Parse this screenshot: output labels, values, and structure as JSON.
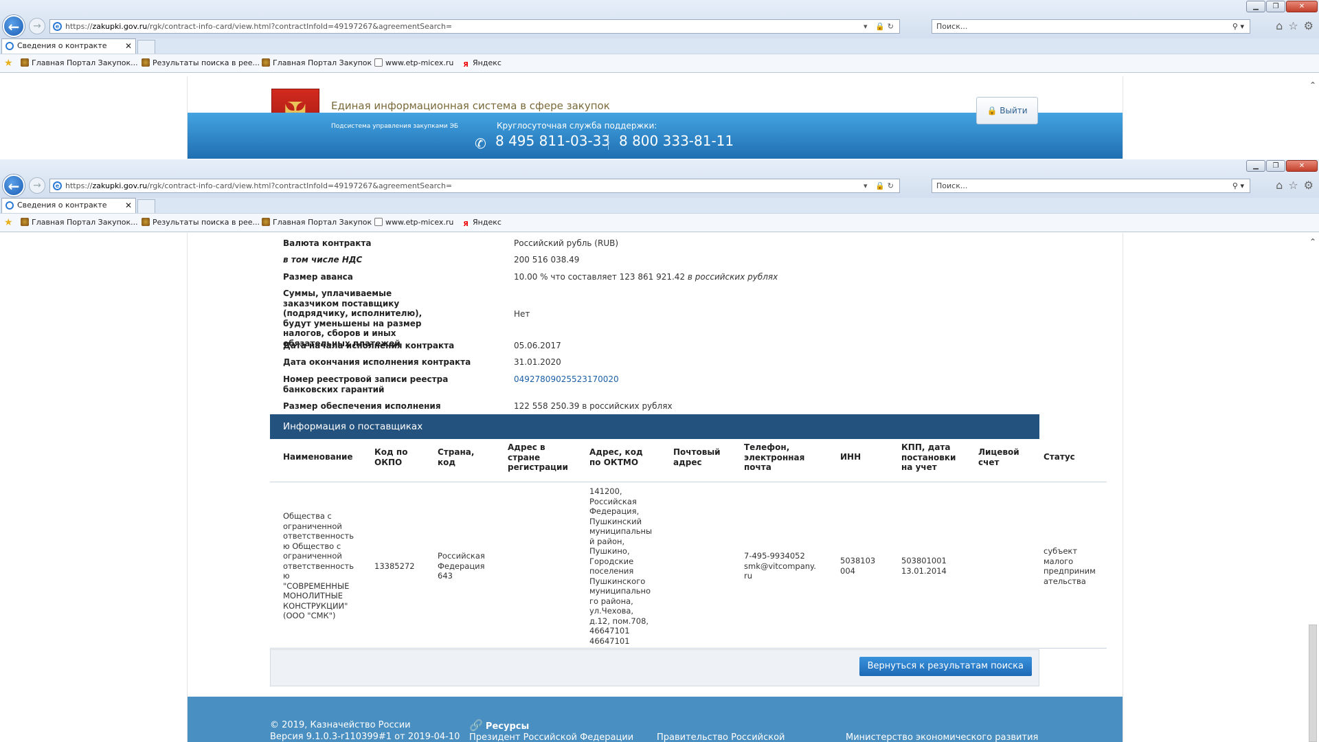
{
  "browser": {
    "url_prefix": "https://",
    "url_domain": "zakupki.gov.ru",
    "url_path": "/rgk/contract-info-card/view.html?contractInfoId=49197267&agreementSearch=",
    "search_placeholder": "Поиск...",
    "tab_title": "Сведения о контракте",
    "favorites": [
      "Главная Портал Закупок...",
      "Результаты поиска в рее...",
      "Главная Портал Закупок",
      "www.etp-micex.ru",
      "Яндекс"
    ]
  },
  "header": {
    "title": "Единая информационная система в сфере закупок",
    "subsystem": "Подсистема управления закупками ЭБ",
    "hotline_label": "Круглосуточная служба поддержки:",
    "phone1": "8 495 811-03-33",
    "phone2": "8 800 333-81-11",
    "logout_label": "Выйти"
  },
  "contract": {
    "rows": [
      {
        "k": "Валюта контракта",
        "v": "Российский рубль (RUB)"
      },
      {
        "k": "в том числе НДС",
        "v": "200 516 038.49"
      },
      {
        "k": "Размер аванса",
        "v": "10.00 % что составляет 123 861 921.42",
        "v_em": "в российских рублях"
      },
      {
        "k": "Суммы, уплачиваемые заказчиком поставщику (подрядчику, исполнителю), будут уменьшены на размер налогов, сборов и иных обязательных платежей",
        "v": "Нет"
      },
      {
        "k": "Дата начала исполнения контракта",
        "v": "05.06.2017"
      },
      {
        "k": "Дата окончания исполнения контракта",
        "v": "31.01.2020"
      },
      {
        "k": "Номер реестровой записи реестра банковских гарантий",
        "v": "04927809025523170020"
      },
      {
        "k": "Размер обеспечения исполнения контракта",
        "v": "122 558 250.39 в российских рублях"
      }
    ]
  },
  "suppliers": {
    "section_title": "Информация о поставщиках",
    "columns": [
      "Наименование",
      "Код по ОКПО",
      "Страна, код",
      "Адрес в стране регистрации",
      "Адрес, код по ОКТМО",
      "Почтовый адрес",
      "Телефон, электронная почта",
      "ИНН",
      "КПП, дата постановки на учет",
      "Лицевой счет",
      "Статус"
    ],
    "row": {
      "name": "Общества с ограниченной ответственность ю Общество с ограниченной ответственность ю \"СОВРЕМЕННЫЕ МОНОЛИТНЫЕ КОНСТРУКЦИИ\" (ООО \"СМК\")",
      "okpo": "13385272",
      "country": "Российская Федерация 643",
      "address_reg": "",
      "address_oktmo": "141200, Российская Федерация, Пушкинский муниципальны й район, Пушкино, Городские поселения Пушкинского муниципально го района, ул.Чехова, д.12, пом.708, 46647101 46647101",
      "postal": "",
      "phone_email": "7-495-9934052 smk@vitcompany. ru",
      "inn": "5038103 004",
      "kpp": "503801001 13.01.2014",
      "account": "",
      "status": "субъект малого предприним ательства"
    },
    "back_button": "Вернуться к результатам поиска"
  },
  "footer": {
    "copyright": "© 2019, Казначейство России",
    "version": "Версия 9.1.0.3-r110399#1 от 2019-04-10",
    "resources_label": "Ресурсы",
    "links": [
      "Президент Российской Федерации",
      "Правительство Российской",
      "Министерство экономического развития"
    ]
  }
}
